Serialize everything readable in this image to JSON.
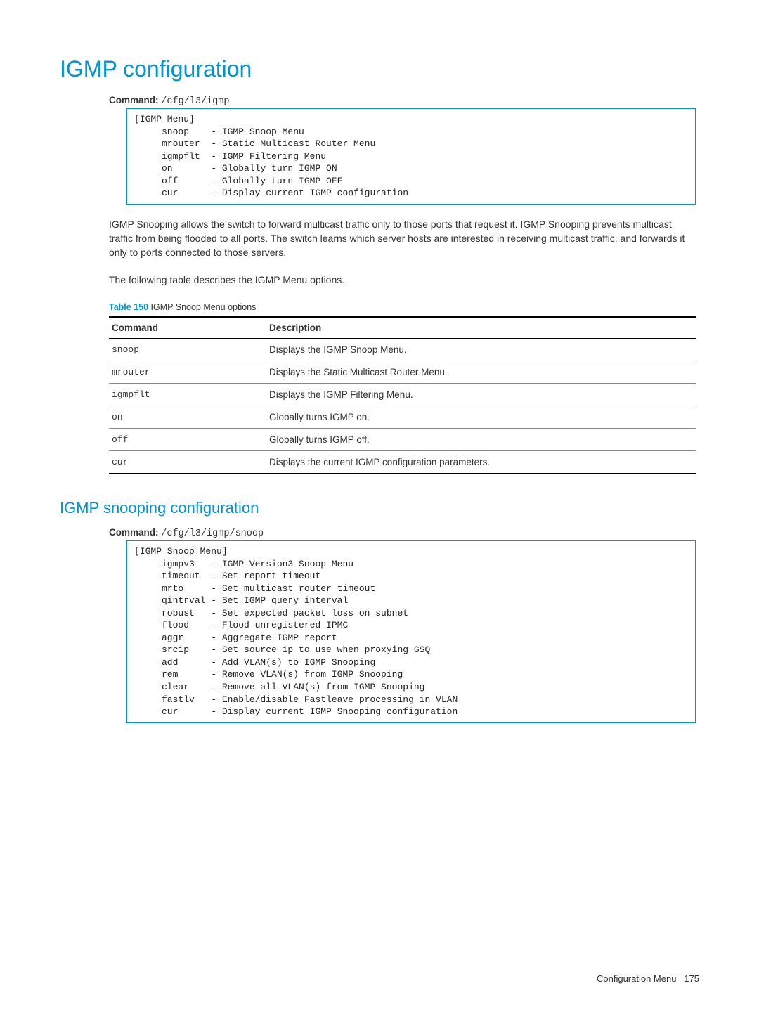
{
  "h1": "IGMP configuration",
  "cmd1_label": "Command:",
  "cmd1_path": "/cfg/l3/igmp",
  "menu1": "[IGMP Menu]\n     snoop    - IGMP Snoop Menu\n     mrouter  - Static Multicast Router Menu\n     igmpflt  - IGMP Filtering Menu\n     on       - Globally turn IGMP ON\n     off      - Globally turn IGMP OFF\n     cur      - Display current IGMP configuration",
  "para1": "IGMP Snooping allows the switch to forward multicast traffic only to those ports that request it. IGMP Snooping prevents multicast traffic from being flooded to all ports. The switch learns which server hosts are interested in receiving multicast traffic, and forwards it only to ports connected to those servers.",
  "para2": "The following table describes the IGMP Menu options.",
  "table_caption_label": "Table 150",
  "table_caption_text": " IGMP Snoop Menu options",
  "table_headers": {
    "col1": "Command",
    "col2": "Description"
  },
  "table_rows": [
    {
      "cmd": "snoop",
      "desc": "Displays the IGMP Snoop Menu."
    },
    {
      "cmd": "mrouter",
      "desc": "Displays the Static Multicast Router Menu."
    },
    {
      "cmd": "igmpflt",
      "desc": "Displays the IGMP Filtering Menu."
    },
    {
      "cmd": "on",
      "desc": "Globally turns IGMP on."
    },
    {
      "cmd": "off",
      "desc": "Globally turns IGMP off."
    },
    {
      "cmd": "cur",
      "desc": "Displays the current IGMP configuration parameters."
    }
  ],
  "h2": "IGMP snooping configuration",
  "cmd2_label": "Command:",
  "cmd2_path": "/cfg/l3/igmp/snoop",
  "menu2": "[IGMP Snoop Menu]\n     igmpv3   - IGMP Version3 Snoop Menu\n     timeout  - Set report timeout\n     mrto     - Set multicast router timeout\n     qintrval - Set IGMP query interval\n     robust   - Set expected packet loss on subnet\n     flood    - Flood unregistered IPMC\n     aggr     - Aggregate IGMP report\n     srcip    - Set source ip to use when proxying GSQ\n     add      - Add VLAN(s) to IGMP Snooping\n     rem      - Remove VLAN(s) from IGMP Snooping\n     clear    - Remove all VLAN(s) from IGMP Snooping\n     fastlv   - Enable/disable Fastleave processing in VLAN\n     cur      - Display current IGMP Snooping configuration",
  "footer_text": "Configuration Menu",
  "footer_page": "175"
}
